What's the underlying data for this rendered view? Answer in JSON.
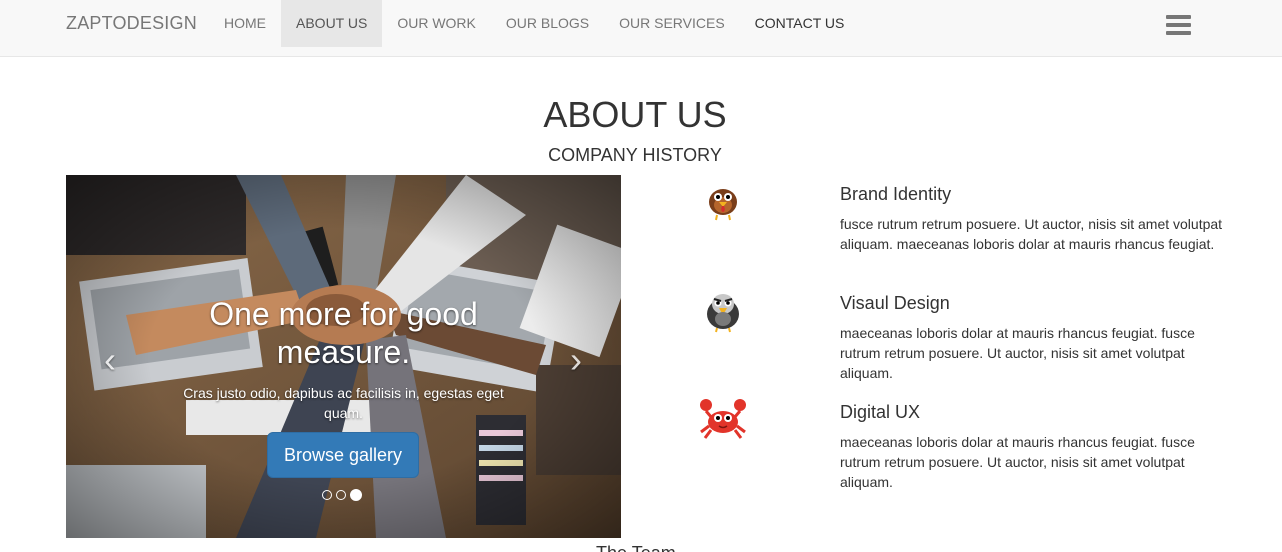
{
  "navbar": {
    "brand": "ZAPTODESIGN",
    "items": [
      {
        "label": "HOME"
      },
      {
        "label": "ABOUT US"
      },
      {
        "label": "OUR WORK"
      },
      {
        "label": "OUR BLOGS"
      },
      {
        "label": "OUR SERVICES"
      },
      {
        "label": "CONTACT US"
      }
    ],
    "active_item": "ABOUT US",
    "menu_icon": "hamburger-menu-icon"
  },
  "page": {
    "title": "ABOUT US",
    "subtitle": "COMPANY HISTORY"
  },
  "carousel": {
    "heading": "One more for good measure.",
    "text": "Cras justo odio, dapibus ac facilisis in, egestas eget quam.",
    "button_label": "Browse gallery",
    "prev_icon": "chevron-left-icon",
    "next_icon": "chevron-right-icon",
    "slide_count": 3,
    "active_slide": 3
  },
  "services": [
    {
      "icon": "turkey-icon",
      "title": "Brand Identity",
      "text": "fusce rutrum retrum posuere. Ut auctor, nisis sit amet volutpat aliquam. maeceanas loboris dolar at mauris rhancus feugiat."
    },
    {
      "icon": "vulture-icon",
      "title": "Visaul Design",
      "text": "maeceanas loboris dolar at mauris rhancus feugiat. fusce rutrum retrum posuere. Ut auctor, nisis sit amet volutpat aliquam."
    },
    {
      "icon": "crab-icon",
      "title": "Digital UX",
      "text": "maeceanas loboris dolar at mauris rhancus feugiat. fusce rutrum retrum posuere. Ut auctor, nisis sit amet volutpat aliquam."
    }
  ],
  "next_section_heading": "The Team",
  "colors": {
    "navbar_bg": "#f8f8f8",
    "active_nav_bg": "#e7e7e7",
    "button_primary": "#337ab7",
    "text_dark": "#333333",
    "text_muted": "#777777"
  }
}
